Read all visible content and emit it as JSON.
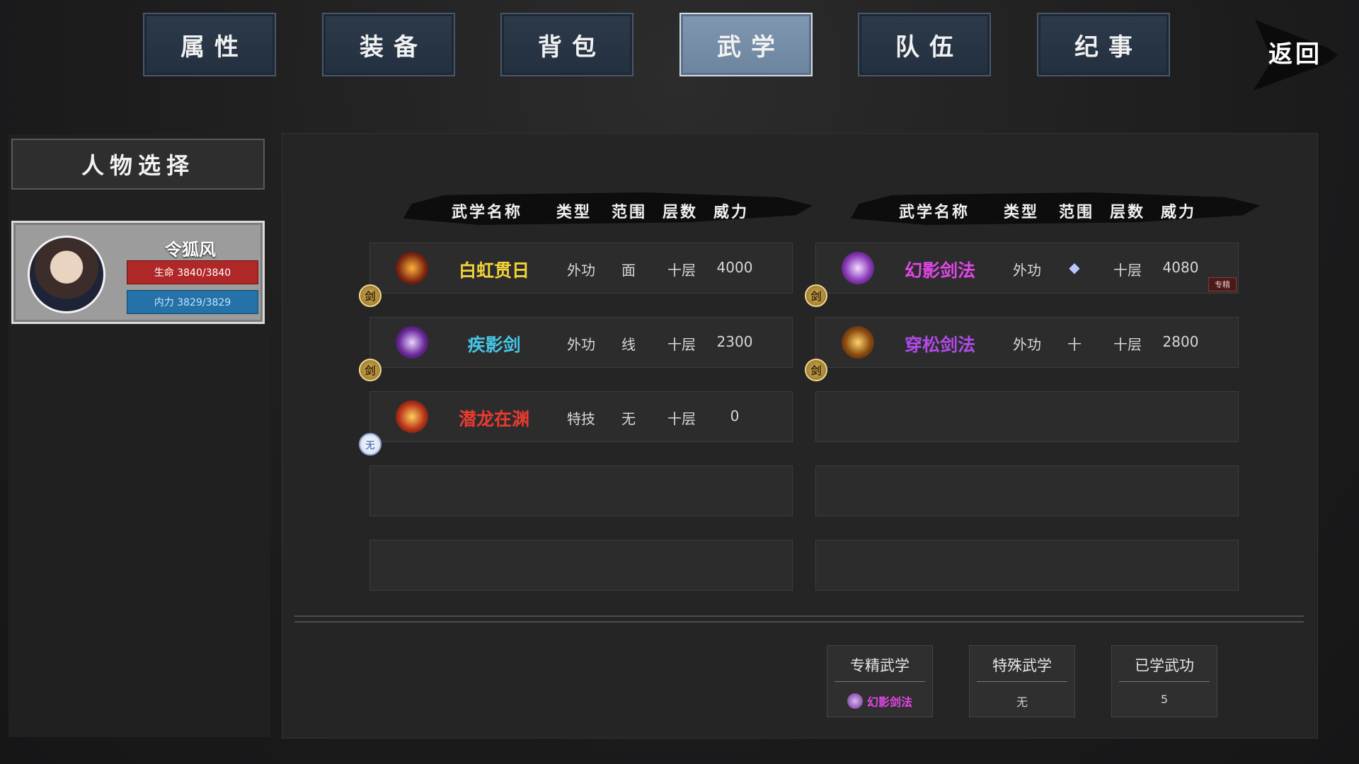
{
  "tabs": [
    {
      "label": "属性",
      "active": false
    },
    {
      "label": "装备",
      "active": false
    },
    {
      "label": "背包",
      "active": false
    },
    {
      "label": "武学",
      "active": true
    },
    {
      "label": "队伍",
      "active": false
    },
    {
      "label": "纪事",
      "active": false
    }
  ],
  "back_label": "返回",
  "left": {
    "title": "人物选择",
    "character": {
      "name": "令狐风",
      "hp": "生命 3840/3840",
      "mp": "内力 3829/3829"
    }
  },
  "headers": {
    "name": "武学名称",
    "type": "类型",
    "range": "范围",
    "level": "层数",
    "power": "威力"
  },
  "skills_left": [
    {
      "name": "白虹贯日",
      "type": "外功",
      "range": "面",
      "level": "十层",
      "power": "4000",
      "badge": "剑",
      "name_color": "#f2d33a"
    },
    {
      "name": "疾影剑",
      "type": "外功",
      "range": "线",
      "level": "十层",
      "power": "2300",
      "badge": "剑",
      "name_color": "#46c6e6"
    },
    {
      "name": "潜龙在渊",
      "type": "特技",
      "range": "无",
      "level": "十层",
      "power": "0",
      "badge": "无",
      "name_color": "#e83b30"
    }
  ],
  "skills_right": [
    {
      "name": "幻影剑法",
      "type": "外功",
      "range": "◆",
      "level": "十层",
      "power": "4080",
      "badge": "剑",
      "name_color": "#e246e6",
      "tag": "专精"
    },
    {
      "name": "穿松剑法",
      "type": "外功",
      "range": "十",
      "level": "十层",
      "power": "2800",
      "badge": "剑",
      "name_color": "#b04ae8"
    }
  ],
  "stats": [
    {
      "title": "专精武学",
      "value": "幻影剑法",
      "value_color": "#e246e6"
    },
    {
      "title": "特殊武学",
      "value": "无"
    },
    {
      "title": "已学武功",
      "value": "5"
    }
  ],
  "colors": {
    "tab_active": "#7f97b0",
    "tab": "#2d3a4a",
    "hp": "#b02727",
    "mp": "#2572a8"
  }
}
